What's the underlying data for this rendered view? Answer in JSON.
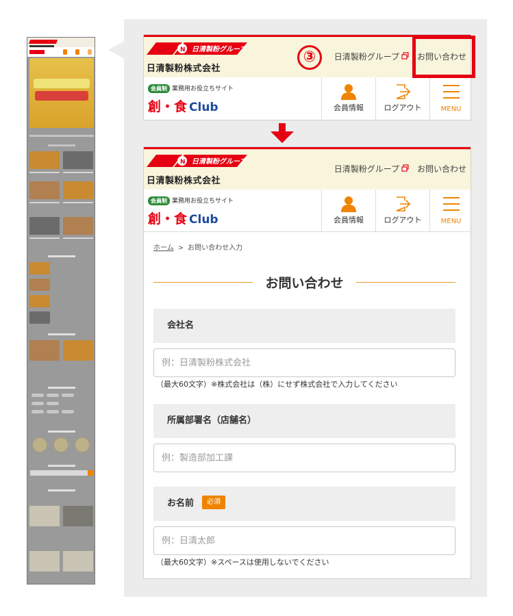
{
  "header": {
    "group_logo_text": "日清製粉グループ",
    "company_name": "日清製粉株式会社",
    "group_link_label": "日清製粉グループ",
    "contact_link_label": "お問い合わせ",
    "club_tag_badge": "会員制",
    "club_tag_text": "業務用お役立ちサイト",
    "club_name_kanji": "創・食",
    "club_name_latin": "Club"
  },
  "nav": {
    "member_info_label": "会員情報",
    "logout_label": "ログアウト",
    "menu_label": "MENU"
  },
  "annotation": {
    "step_number": "③",
    "accent_color": "#e60012"
  },
  "breadcrumb": {
    "home": "ホーム",
    "separator": ">",
    "current": "お問い合わせ入力"
  },
  "page_title": "お問い合わせ",
  "form": {
    "company": {
      "label": "会社名",
      "placeholder": "例：日清製粉株式会社",
      "note": "（最大60文字）※株式会社は（株）にせず株式会社で入力してください"
    },
    "department": {
      "label": "所属部署名（店舗名）",
      "placeholder": "例：製造部加工課"
    },
    "name": {
      "label": "お名前",
      "required_badge": "必須",
      "placeholder": "例：日清太郎",
      "note": "（最大60文字）※スペースは使用しないでください"
    }
  },
  "colors": {
    "brand_red": "#e60012",
    "accent_orange": "#f08300",
    "header_band": "#f8f5dc"
  }
}
